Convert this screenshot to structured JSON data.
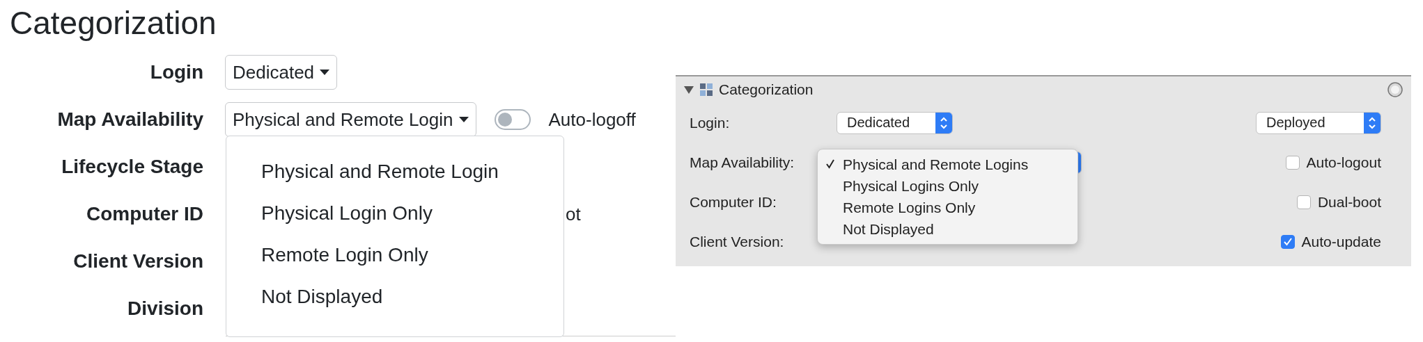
{
  "web_form": {
    "title": "Categorization",
    "rows": [
      {
        "label": "Login",
        "select": "Dedicated"
      },
      {
        "label": "Map Availability",
        "select": "Physical and Remote Login",
        "toggle": {
          "label": "Auto-logoff",
          "on": false
        }
      },
      {
        "label": "Lifecycle Stage"
      },
      {
        "label": "Computer ID",
        "trailing": "ot"
      },
      {
        "label": "Client Version"
      },
      {
        "label": "Division"
      }
    ],
    "menu": {
      "items": [
        {
          "label": "Physical and Remote Login"
        },
        {
          "label": "Physical Login Only"
        },
        {
          "label": "Remote Login Only"
        },
        {
          "label": "Not Displayed"
        }
      ]
    }
  },
  "mac_panel": {
    "title": "Categorization",
    "expanded": true,
    "rows": [
      {
        "label": "Login:",
        "select": "Dedicated",
        "right": {
          "kind": "select",
          "value": "Deployed"
        }
      },
      {
        "label": "Map Availability:",
        "select_hidden": true,
        "right": {
          "kind": "checkbox",
          "label": "Auto-logout",
          "checked": false
        }
      },
      {
        "label": "Computer ID:",
        "right": {
          "kind": "checkbox",
          "label": "Dual-boot",
          "checked": false
        }
      },
      {
        "label": "Client Version:",
        "right": {
          "kind": "checkbox",
          "label": "Auto-update",
          "checked": true
        }
      }
    ],
    "menu": {
      "items": [
        {
          "label": "Physical and Remote Logins",
          "selected": true
        },
        {
          "label": "Physical Logins Only",
          "selected": false
        },
        {
          "label": "Remote Logins Only",
          "selected": false
        },
        {
          "label": "Not Displayed",
          "selected": false
        }
      ]
    }
  }
}
